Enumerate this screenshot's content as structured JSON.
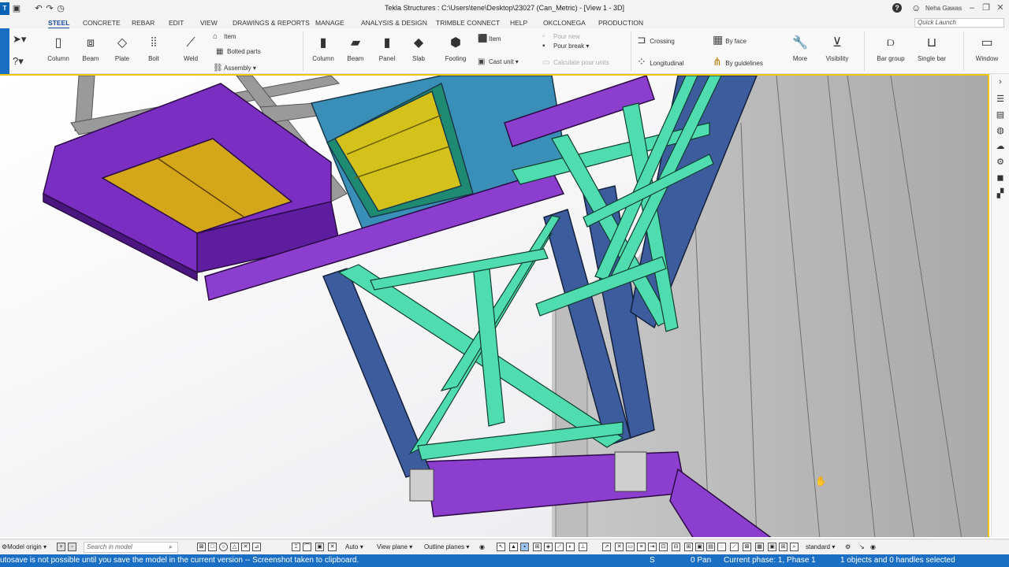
{
  "window": {
    "title": "Tekla Structures : C:\\Users\\tene\\Desktop\\23027 (Can_Metric) - [View 1 - 3D]",
    "user": "Neha Gawas",
    "quick_launch_placeholder": "Quick Launch"
  },
  "tabs": [
    "STEEL",
    "CONCRETE",
    "REBAR",
    "EDIT",
    "VIEW",
    "DRAWINGS & REPORTS",
    "MANAGE",
    "ANALYSIS & DESIGN",
    "TRIMBLE CONNECT",
    "HELP",
    "OKCLONEGA",
    "PRODUCTION"
  ],
  "active_tab": "STEEL",
  "ribbon": {
    "steel": {
      "column": "Column",
      "beam": "Beam",
      "plate": "Plate",
      "bolt": "Bolt",
      "weld": "Weld",
      "item": "Item",
      "bolted_parts": "Bolted parts",
      "assembly": "Assembly"
    },
    "concrete": {
      "column": "Column",
      "beam": "Beam",
      "panel": "Panel",
      "slab": "Slab",
      "footing": "Footing",
      "item": "Item",
      "cast_unit": "Cast unit",
      "pour_new": "Pour new",
      "pour_break": "Pour break",
      "calculate_pour_units": "Calculate pour units"
    },
    "rebar": {
      "crossing": "Crossing",
      "longitudinal": "Longitudinal",
      "by_face": "By face",
      "by_guidelines": "By guidelines",
      "more": "More",
      "visibility": "Visibility",
      "bar_group": "Bar group",
      "single_bar": "Single bar",
      "window": "Window"
    }
  },
  "bottom_toolbar": {
    "model_origin": "Model origin",
    "search_placeholder": "Search in model",
    "auto": "Auto",
    "view_plane": "View plane",
    "outline_planes": "Outline planes",
    "standard": "standard"
  },
  "status": {
    "message": "utosave is not possible until you save the model in the current version -- Screenshot taken to clipboard.",
    "s": "S",
    "pan": "0 Pan",
    "phase": "Current phase: 1, Phase 1",
    "selection": "1 objects and 0 handles selected"
  },
  "colors": {
    "accent_blue": "#1a6fc4",
    "viewport_border": "#f1c40f",
    "purple": "#7b2fbf",
    "teal": "#45d6a8",
    "navy": "#3a5a9c",
    "yellow": "#d4c21a",
    "hopper_blue": "#3a8fb8"
  },
  "icons": [
    "select-arrow-icon",
    "help-icon",
    "undo-icon",
    "redo-icon",
    "column-icon",
    "beam-icon",
    "plate-icon",
    "bolt-icon",
    "weld-icon",
    "crossing-icon",
    "by-face-icon",
    "more-icon",
    "visibility-icon",
    "window-icon",
    "hand-cursor-icon"
  ]
}
